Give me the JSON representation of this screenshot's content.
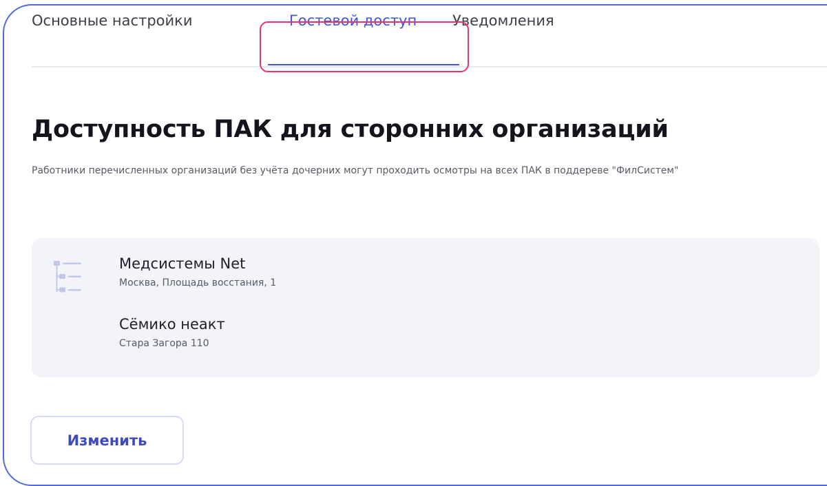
{
  "tabs": [
    {
      "label": "Основные настройки",
      "active": false
    },
    {
      "label": "Гостевой доступ",
      "active": true
    },
    {
      "label": "Уведомления",
      "active": false
    }
  ],
  "section": {
    "title": "Доступность ПАК для сторонних организаций",
    "description": "Работники перечисленных организаций без учёта дочерних могут проходить осмотры на всех ПАК в поддереве \"ФилСистем\""
  },
  "organizations": [
    {
      "name": "Медсистемы Net",
      "address": "Москва, Площадь восстания, 1"
    },
    {
      "name": "Сёмико неакт",
      "address": "Стара Загора 110"
    }
  ],
  "actions": {
    "edit_label": "Изменить"
  },
  "colors": {
    "accent": "#4255d6",
    "highlight": "#e8326e",
    "frame": "#5468df",
    "card_background": "#f3f4fa"
  },
  "icons": {
    "organizations": "tree-list-icon"
  }
}
